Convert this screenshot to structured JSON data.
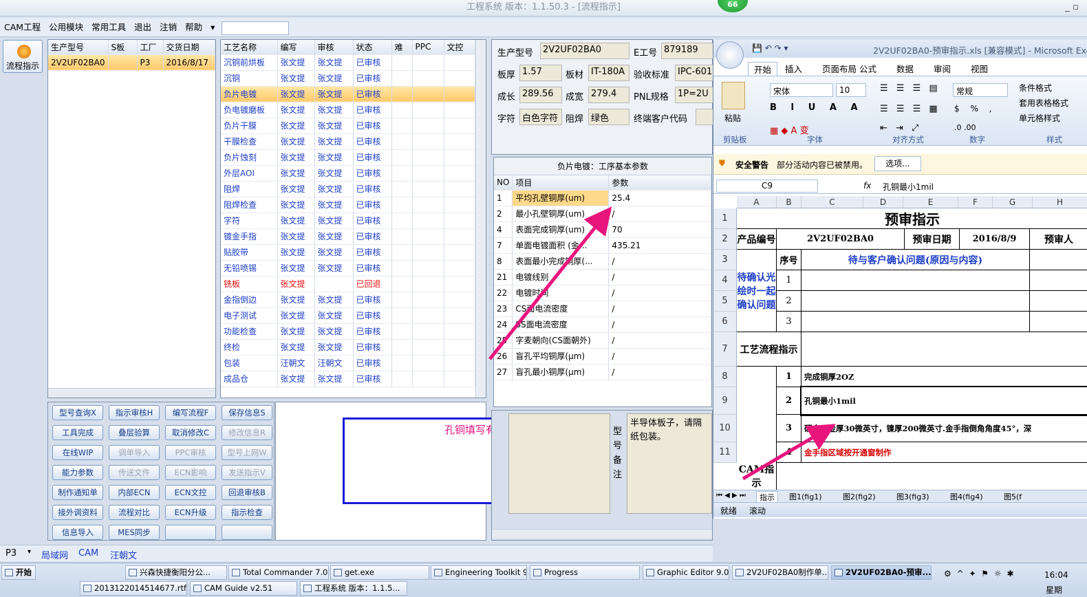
{
  "window": {
    "title": "工程系统  版本：1.1.50.3 - [流程指示]",
    "badge": "66"
  },
  "menu": [
    "CAM工程",
    "公用模块",
    "常用工具",
    "退出",
    "注销",
    "帮助"
  ],
  "left_button": "流程指示",
  "product_grid": {
    "headers": [
      "生产型号",
      "S板",
      "工厂",
      "交货日期"
    ],
    "rows": [
      [
        "2V2UF02BA0",
        "",
        "P3",
        "2016/8/17"
      ]
    ]
  },
  "process_grid": {
    "headers": [
      "工艺名称",
      "编写",
      "审核",
      "状态",
      "难",
      "PPC",
      "文控"
    ],
    "rows": [
      [
        "沉铜前烘板",
        "张文提",
        "张文提",
        "已审核"
      ],
      [
        "沉铜",
        "张文提",
        "张文提",
        "已审核"
      ],
      [
        "负片电镀",
        "张文提",
        "张文提",
        "已审核"
      ],
      [
        "负电镀磨板",
        "张文提",
        "张文提",
        "已审核"
      ],
      [
        "负片干膜",
        "张文提",
        "张文提",
        "已审核"
      ],
      [
        "干膜检查",
        "张文提",
        "张文提",
        "已审核"
      ],
      [
        "负片蚀刻",
        "张文提",
        "张文提",
        "已审核"
      ],
      [
        "外层AOI",
        "张文提",
        "张文提",
        "已审核"
      ],
      [
        "阻焊",
        "张文提",
        "张文提",
        "已审核"
      ],
      [
        "阻焊检查",
        "张文提",
        "张文提",
        "已审核"
      ],
      [
        "字符",
        "张文提",
        "张文提",
        "已审核"
      ],
      [
        "镀金手指",
        "张文提",
        "张文提",
        "已审核"
      ],
      [
        "贴胶带",
        "张文提",
        "张文提",
        "已审核"
      ],
      [
        "无铅喷锡",
        "张文提",
        "张文提",
        "已审核"
      ],
      [
        "铣板",
        "张文提",
        "",
        "已回退"
      ],
      [
        "金指倒边",
        "张文提",
        "张文提",
        "已审核"
      ],
      [
        "电子测试",
        "张文提",
        "张文提",
        "已审核"
      ],
      [
        "功能检查",
        "张文提",
        "张文提",
        "已审核"
      ],
      [
        "终检",
        "张文提",
        "张文提",
        "已审核"
      ],
      [
        "包装",
        "汪朝文",
        "汪朝文",
        "已审核"
      ],
      [
        "成品仓",
        "张文提",
        "张文提",
        "已审核"
      ]
    ]
  },
  "buttons": [
    [
      "型号查询X",
      "指示审核H",
      "编写流程F",
      "保存信息S"
    ],
    [
      "工具完成",
      "叠层验算",
      "取消修改C",
      "修改信息R"
    ],
    [
      "在线WIP",
      "调单导入",
      "PPC审核",
      "型号上网W"
    ],
    [
      "能力参数",
      "传送文件",
      "ECN影响",
      "发送指示V"
    ],
    [
      "制作通知单",
      "内部ECN",
      "ECN文控",
      "回退审核B"
    ],
    [
      "接外调资料",
      "流程对比",
      "ECN升级",
      "指示检查"
    ],
    [
      "信息导入",
      "MES同步",
      "",
      ""
    ]
  ],
  "annotation_text": "孔铜填写有误",
  "info": {
    "labels": [
      "生产型号",
      "E工号",
      "板厚",
      "板材",
      "验收标准",
      "成长",
      "成宽",
      "PNL规格",
      "字符",
      "阻焊",
      "终端客户代码"
    ],
    "values": [
      "2V2UF02BA0",
      "879189",
      "1.57",
      "IT-180A",
      "IPC-601",
      "289.56",
      "279.4",
      "1P=2U",
      "白色字符",
      "绿色",
      ""
    ]
  },
  "param_panel": {
    "title": "负片电镀：工序基本参数",
    "headers": [
      "NO",
      "项目",
      "参数"
    ],
    "rows": [
      [
        "1",
        "平均孔壁铜厚(um)",
        "25.4"
      ],
      [
        "2",
        "最小孔壁铜厚(um)",
        "/"
      ],
      [
        "4",
        "表面完成铜厚(um)",
        "70"
      ],
      [
        "7",
        "单面电镀面积 (金...",
        "435.21"
      ],
      [
        "8",
        "表面最小完成铜厚(...",
        "/"
      ],
      [
        "21",
        "电镀线别",
        "/"
      ],
      [
        "22",
        "电镀时间",
        "/"
      ],
      [
        "23",
        "CS面电流密度",
        "/"
      ],
      [
        "24",
        "SS面电流密度",
        "/"
      ],
      [
        "25",
        "字麦朝向(CS面朝外)",
        "/"
      ],
      [
        "26",
        "盲孔平均铜厚(μm)",
        "/"
      ],
      [
        "27",
        "盲孔最小铜厚(μm)",
        "/"
      ]
    ]
  },
  "remark": {
    "label": "型号备注",
    "text": "半导体板子，请隔纸包装。"
  },
  "status_tabs": [
    "P3",
    "局域网",
    "CAM",
    "汪朝文"
  ],
  "excel": {
    "title": "2V2UF02BA0-预审指示.xls  [兼容模式] - Microsoft Exc",
    "tabs": [
      "开始",
      "插入",
      "页面布局",
      "公式",
      "数据",
      "审阅",
      "视图"
    ],
    "font": "宋体",
    "size": "10",
    "numfmt": "常规",
    "groups": [
      "剪贴板",
      "字体",
      "对齐方式",
      "数字",
      "样式"
    ],
    "paste": "粘贴",
    "styles": [
      "条件格式",
      "套用表格格式",
      "单元格样式"
    ],
    "security": "安全警告",
    "security_msg": "部分活动内容已被禁用。",
    "options": "选项...",
    "cellref": "C9",
    "formula": "孔铜最小1mil",
    "cols": [
      "A",
      "B",
      "C",
      "D",
      "E",
      "F",
      "G",
      "H"
    ],
    "rows": [
      "1",
      "2",
      "3",
      "4",
      "5",
      "6",
      "7",
      "8",
      "9",
      "10",
      "11"
    ],
    "doc_title": "预审指示",
    "product_label": "产品编号",
    "product_no": "2V2UF02BA0",
    "date_label": "预审日期",
    "date": "2016/8/9",
    "reviewer": "预审人",
    "seq": "序号",
    "confirm_title": "待与客户确认问题(原因与内容)",
    "pending_label": "待确认光绘时一起确认问题",
    "flow_label": "工艺流程指示",
    "cam_label": "CAM指示",
    "items": [
      [
        "1",
        "完成铜厚2OZ"
      ],
      [
        "2",
        "孔铜最小1mil"
      ],
      [
        "3",
        "硬金：金厚30微英寸，镍厚200微英寸.金手指倒角角度45°，深"
      ],
      [
        "4",
        "金手指区域按开通窗制作"
      ]
    ],
    "sheets": [
      "指示",
      "图1(fig1)",
      "图2(fig2)",
      "图3(fig3)",
      "图4(fig4)",
      "图5(f"
    ],
    "status": [
      "就绪",
      "滚动"
    ]
  },
  "taskbar": {
    "start": "开始",
    "clock": "16:04",
    "day": "星期",
    "items": [
      "兴森快捷衡阳分公...",
      "Total Commander 7.0 ...",
      "get.exe",
      "Engineering Toolkit 9....",
      "Progress",
      "Graphic Editor 9.07b2...",
      "2V2UF02BA0制作单...",
      "2V2UF02BA0-预审...",
      "20131220145146​77.rtf [...",
      "CAM  Guide v2.51",
      "工程系统  版本：1.1.5..."
    ]
  },
  "colors": {
    "annotation_arrow": "#e8157d",
    "annotation_box": "#1a1ad8",
    "selected_row": "#ffc86b",
    "link_blue": "#1d3ec8"
  }
}
